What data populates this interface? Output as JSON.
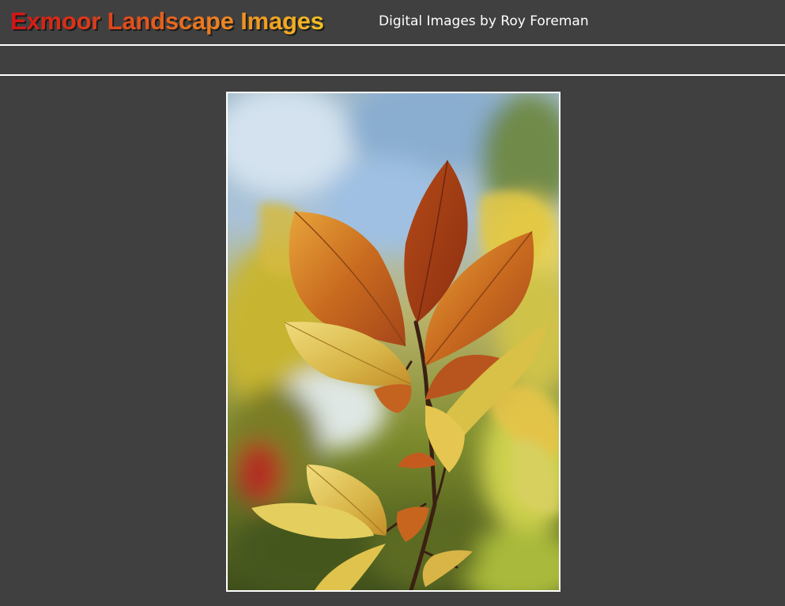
{
  "header": {
    "site_title": "Exmoor Landscape Images",
    "subtitle": "Digital Images by Roy Foreman"
  },
  "nav": {
    "items": []
  },
  "main": {
    "photo_subject": "autumn beech leaves"
  },
  "colors": {
    "background": "#404040",
    "divider": "#ffffff",
    "title_gradient_start": "#d21414",
    "title_gradient_end": "#f4c023",
    "subtitle": "#ffffff"
  }
}
